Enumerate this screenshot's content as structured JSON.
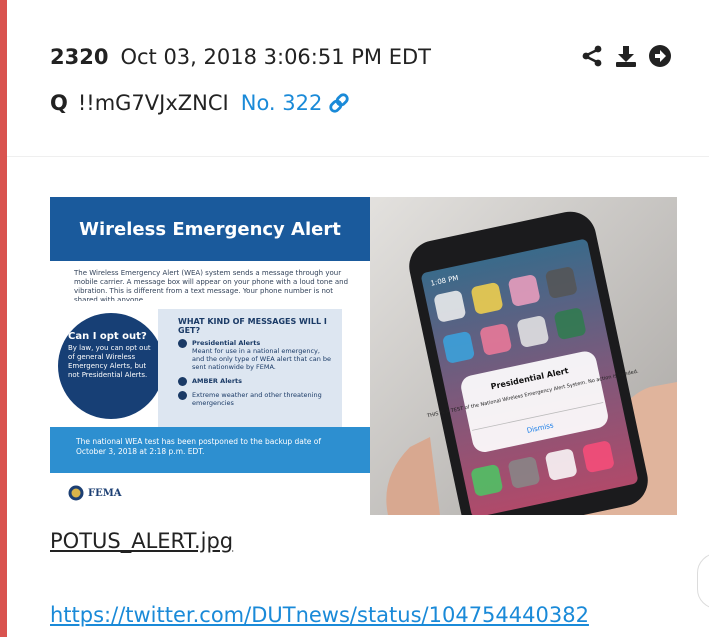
{
  "post": {
    "number": "2320",
    "datetime": "Oct 03, 2018 3:06:51 PM EDT",
    "author": "Q",
    "tripcode": "!!mG7VJxZNCI",
    "post_ref": "No. 322"
  },
  "actions": [
    "share-icon",
    "download-icon",
    "arrow-right-circle-icon"
  ],
  "attachment": {
    "filename": "POTUS_ALERT.jpg",
    "poster": {
      "title": "Wireless Emergency Alert",
      "intro": "The Wireless Emergency Alert (WEA) system sends a message through your mobile carrier. A message box will appear on your phone with a loud tone and vibration. This is different from a text message. Your phone number is not shared with anyone.",
      "optout_title": "Can I opt out?",
      "optout_text": "By law, you can opt out of general Wireless Emergency Alerts, but not Presidential Alerts.",
      "messages_heading": "WHAT KIND OF MESSAGES WILL I GET?",
      "item1_title": "Presidential Alerts",
      "item1_text": "Meant for use in a national emergency, and the only type of WEA alert that can be sent nationwide by FEMA.",
      "item2_title": "AMBER Alerts",
      "item3_text": "Extreme weather and other threatening emergencies",
      "notice": "The national WEA test has been postponed to the backup date of October 3, 2018 at 2:18 p.m. EDT.",
      "agency": "FEMA"
    },
    "phone": {
      "status_time": "1:08 PM",
      "alert_title": "Presidential Alert",
      "alert_body": "THIS IS A TEST of the National Wireless Emergency Alert System. No action is needed.",
      "dismiss": "Dismiss"
    }
  },
  "link": {
    "text": "https://twitter.com/DUTnews/status/104754440382"
  },
  "colors": {
    "accent_bar": "#d9534f",
    "link": "#1a8ad8",
    "poster_blue": "#1a5a9c"
  }
}
